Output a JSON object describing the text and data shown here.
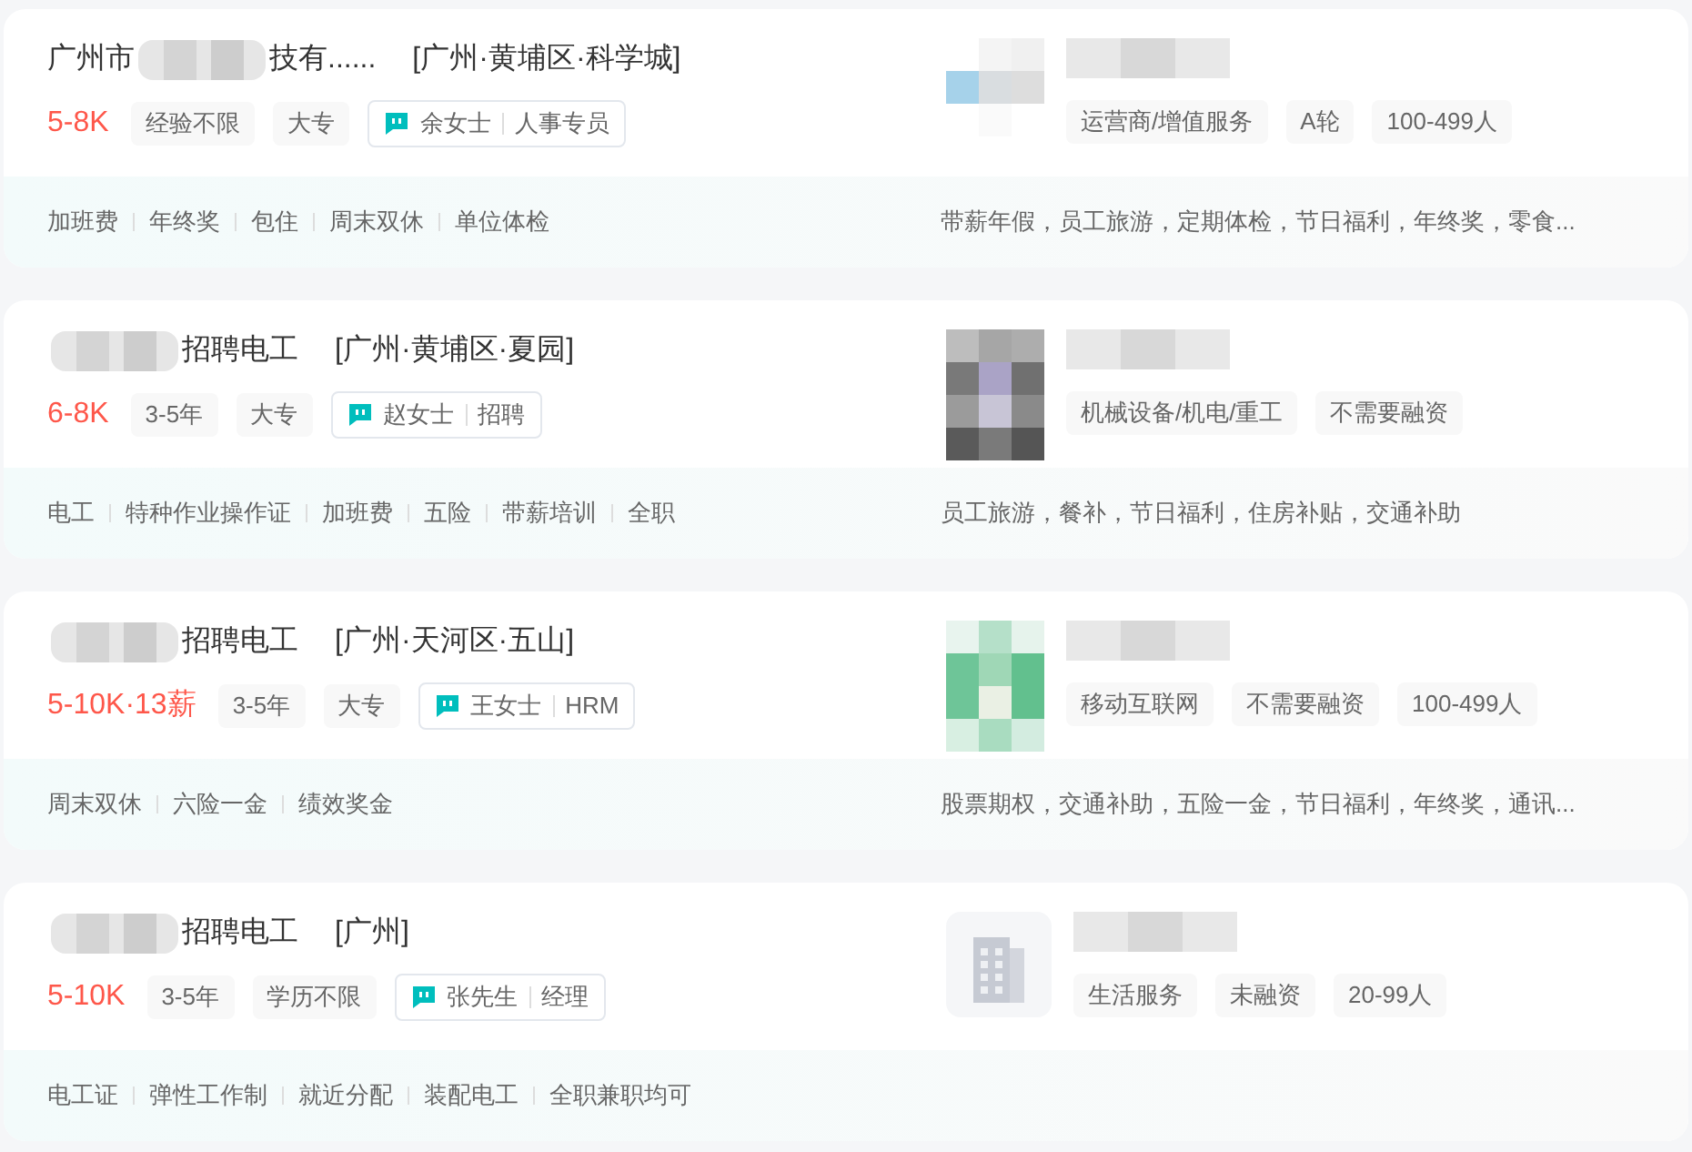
{
  "jobs": [
    {
      "title_parts": [
        {
          "kind": "text",
          "text": "广州市"
        },
        {
          "kind": "redacted"
        },
        {
          "kind": "text",
          "text": "技有......"
        }
      ],
      "location": "[广州·黄埔区·科学城]",
      "salary": "5-8K",
      "requirements": [
        "经验不限",
        "大专"
      ],
      "contact": {
        "name": "余女士",
        "role": "人事专员"
      },
      "logo": {
        "kind": "pixelated"
      },
      "company_tags": [
        "运营商/增值服务",
        "A轮",
        "100-499人"
      ],
      "skills": [
        "加班费",
        "年终奖",
        "包住",
        "周末双休",
        "单位体检"
      ],
      "welfare": "带薪年假，员工旅游，定期体检，节日福利，年终奖，零食..."
    },
    {
      "title_parts": [
        {
          "kind": "redacted"
        },
        {
          "kind": "text",
          "text": "招聘电工"
        }
      ],
      "location": "[广州·黄埔区·夏园]",
      "salary": "6-8K",
      "requirements": [
        "3-5年",
        "大专"
      ],
      "contact": {
        "name": "赵女士",
        "role": "招聘"
      },
      "logo": {
        "kind": "pixelated"
      },
      "company_tags": [
        "机械设备/机电/重工",
        "不需要融资"
      ],
      "skills": [
        "电工",
        "特种作业操作证",
        "加班费",
        "五险",
        "带薪培训",
        "全职"
      ],
      "welfare": "员工旅游，餐补，节日福利，住房补贴，交通补助"
    },
    {
      "title_parts": [
        {
          "kind": "redacted"
        },
        {
          "kind": "text",
          "text": "招聘电工"
        }
      ],
      "location": "[广州·天河区·五山]",
      "salary": "5-10K·13薪",
      "requirements": [
        "3-5年",
        "大专"
      ],
      "contact": {
        "name": "王女士",
        "role": "HRM"
      },
      "logo": {
        "kind": "pixelated"
      },
      "company_tags": [
        "移动互联网",
        "不需要融资",
        "100-499人"
      ],
      "skills": [
        "周末双休",
        "六险一金",
        "绩效奖金"
      ],
      "welfare": "股票期权，交通补助，五险一金，节日福利，年终奖，通讯..."
    },
    {
      "title_parts": [
        {
          "kind": "redacted"
        },
        {
          "kind": "text",
          "text": "招聘电工"
        }
      ],
      "location": "[广州]",
      "salary": "5-10K",
      "requirements": [
        "3-5年",
        "学历不限"
      ],
      "contact": {
        "name": "张先生",
        "role": "经理"
      },
      "logo": {
        "kind": "building"
      },
      "company_tags": [
        "生活服务",
        "未融资",
        "20-99人"
      ],
      "skills": [
        "电工证",
        "弹性工作制",
        "就近分配",
        "装配电工",
        "全职兼职均可"
      ]
    }
  ]
}
